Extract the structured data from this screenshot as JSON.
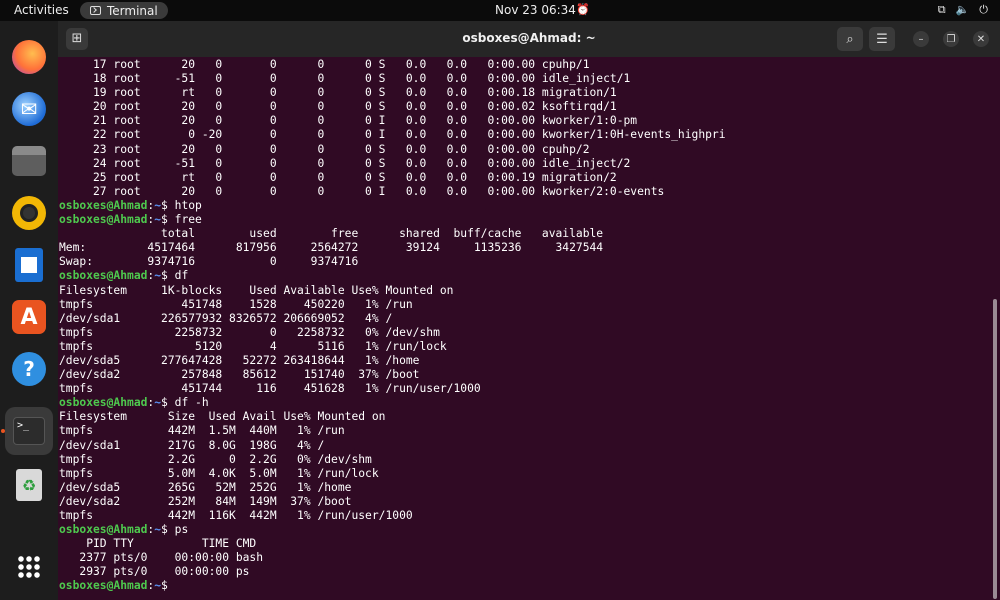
{
  "topbar": {
    "activities": "Activities",
    "app_name": "Terminal",
    "clock": "Nov 23  06:34"
  },
  "dock": {
    "items": [
      {
        "name": "firefox-icon"
      },
      {
        "name": "thunderbird-icon"
      },
      {
        "name": "files-icon"
      },
      {
        "name": "rhythmbox-icon"
      },
      {
        "name": "libreoffice-writer-icon"
      },
      {
        "name": "software-center-icon"
      },
      {
        "name": "help-icon"
      },
      {
        "name": "terminal-icon"
      },
      {
        "name": "trash-icon"
      },
      {
        "name": "show-apps-icon"
      }
    ]
  },
  "window": {
    "title": "osboxes@Ahmad: ~"
  },
  "terminal": {
    "prompt_user": "osboxes@Ahmad",
    "prompt_path": "~",
    "lines": [
      {
        "text": "     17 root      20   0       0      0      0 S   0.0   0.0   0:00.00 cpuhp/1"
      },
      {
        "text": "     18 root     -51   0       0      0      0 S   0.0   0.0   0:00.00 idle_inject/1"
      },
      {
        "text": "     19 root      rt   0       0      0      0 S   0.0   0.0   0:00.18 migration/1"
      },
      {
        "text": "     20 root      20   0       0      0      0 S   0.0   0.0   0:00.02 ksoftirqd/1"
      },
      {
        "text": "     21 root      20   0       0      0      0 I   0.0   0.0   0:00.00 kworker/1:0-pm"
      },
      {
        "text": "     22 root       0 -20       0      0      0 I   0.0   0.0   0:00.00 kworker/1:0H-events_highpri"
      },
      {
        "text": "     23 root      20   0       0      0      0 S   0.0   0.0   0:00.00 cpuhp/2"
      },
      {
        "text": "     24 root     -51   0       0      0      0 S   0.0   0.0   0:00.00 idle_inject/2"
      },
      {
        "text": "     25 root      rt   0       0      0      0 S   0.0   0.0   0:00.19 migration/2"
      },
      {
        "text": "     27 root      20   0       0      0      0 I   0.0   0.0   0:00.00 kworker/2:0-events"
      },
      {
        "cmd": "htop"
      },
      {
        "cmd": "free"
      },
      {
        "text": "               total        used        free      shared  buff/cache   available"
      },
      {
        "text": "Mem:         4517464      817956     2564272       39124     1135236     3427544"
      },
      {
        "text": "Swap:        9374716           0     9374716"
      },
      {
        "cmd": "df"
      },
      {
        "text": "Filesystem     1K-blocks    Used Available Use% Mounted on"
      },
      {
        "text": "tmpfs             451748    1528    450220   1% /run"
      },
      {
        "text": "/dev/sda1      226577932 8326572 206669052   4% /"
      },
      {
        "text": "tmpfs            2258732       0   2258732   0% /dev/shm"
      },
      {
        "text": "tmpfs               5120       4      5116   1% /run/lock"
      },
      {
        "text": "/dev/sda5      277647428   52272 263418644   1% /home"
      },
      {
        "text": "/dev/sda2         257848   85612    151740  37% /boot"
      },
      {
        "text": "tmpfs             451744     116    451628   1% /run/user/1000"
      },
      {
        "cmd": "df -h"
      },
      {
        "text": "Filesystem      Size  Used Avail Use% Mounted on"
      },
      {
        "text": "tmpfs           442M  1.5M  440M   1% /run"
      },
      {
        "text": "/dev/sda1       217G  8.0G  198G   4% /"
      },
      {
        "text": "tmpfs           2.2G     0  2.2G   0% /dev/shm"
      },
      {
        "text": "tmpfs           5.0M  4.0K  5.0M   1% /run/lock"
      },
      {
        "text": "/dev/sda5       265G   52M  252G   1% /home"
      },
      {
        "text": "/dev/sda2       252M   84M  149M  37% /boot"
      },
      {
        "text": "tmpfs           442M  116K  442M   1% /run/user/1000"
      },
      {
        "cmd": "ps"
      },
      {
        "text": "    PID TTY          TIME CMD"
      },
      {
        "text": "   2377 pts/0    00:00:00 bash"
      },
      {
        "text": "   2937 pts/0    00:00:00 ps"
      },
      {
        "cmd": ""
      }
    ]
  },
  "colors": {
    "terminal_bg": "#300a24",
    "prompt_user": "#4ec94e",
    "prompt_path": "#5a8ff0",
    "accent": "#e95420"
  }
}
